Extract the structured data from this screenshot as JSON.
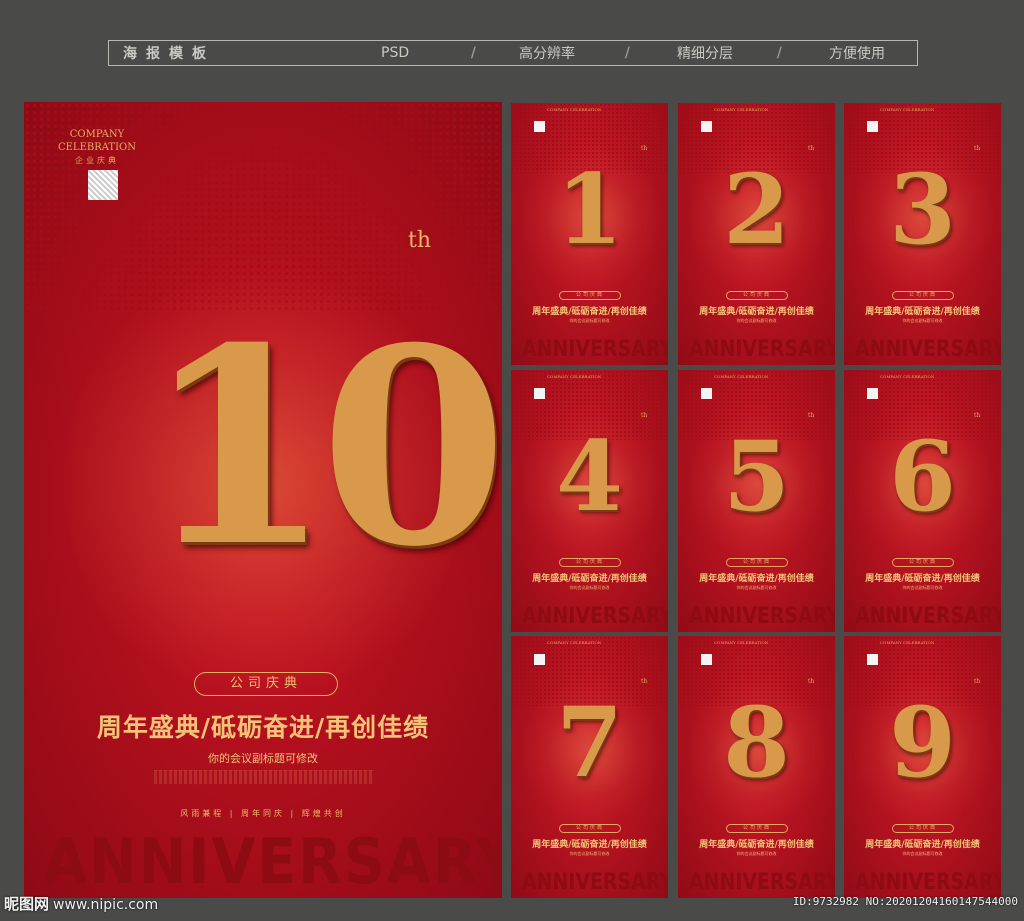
{
  "header": {
    "title": "海报模板",
    "items": [
      "PSD",
      "高分辨率",
      "精细分层",
      "方便使用"
    ],
    "separator": "/"
  },
  "main_poster": {
    "company_en": "COMPANY CELEBRATION",
    "company_cn": "企业庆典",
    "number": "10",
    "suffix": "th",
    "tag": "公司庆典",
    "slogan": "周年盛典/砥砺奋进/再创佳绩",
    "subtitle": "你的会议副标题可修改",
    "motto": "风雨兼程 | 周年同庆 | 辉煌共创",
    "anniversary": "ANNIVERSARY"
  },
  "small_posters": [
    {
      "digit": "1",
      "slogan": "周年盛典/砥砺奋进/再创佳绩",
      "anniversary": "ANNIVERSARY"
    },
    {
      "digit": "2",
      "slogan": "周年盛典/砥砺奋进/再创佳绩",
      "anniversary": "ANNIVERSARY"
    },
    {
      "digit": "3",
      "slogan": "周年盛典/砥砺奋进/再创佳绩",
      "anniversary": "ANNIVERSARY"
    },
    {
      "digit": "4",
      "slogan": "周年盛典/砥砺奋进/再创佳绩",
      "anniversary": "ANNIVERSARY"
    },
    {
      "digit": "5",
      "slogan": "周年盛典/砥砺奋进/再创佳绩",
      "anniversary": "ANNIVERSARY"
    },
    {
      "digit": "6",
      "slogan": "周年盛典/砥砺奋进/再创佳绩",
      "anniversary": "ANNIVERSARY"
    },
    {
      "digit": "7",
      "slogan": "周年盛典/砥砺奋进/再创佳绩",
      "anniversary": "ANNIVERSARY"
    },
    {
      "digit": "8",
      "slogan": "周年盛典/砥砺奋进/再创佳绩",
      "anniversary": "ANNIVERSARY"
    },
    {
      "digit": "9",
      "slogan": "周年盛典/砥砺奋进/再创佳绩",
      "anniversary": "ANNIVERSARY"
    }
  ],
  "watermark": {
    "site_name": "昵图网",
    "site_url": "www.nipic.com",
    "id_text": "ID:9732982 NO:20201204160147544000"
  },
  "colors": {
    "background": "#4a4a48",
    "poster_red": "#b51320",
    "gold": "#d9994a",
    "anniversary_red": "#8d0b12"
  }
}
